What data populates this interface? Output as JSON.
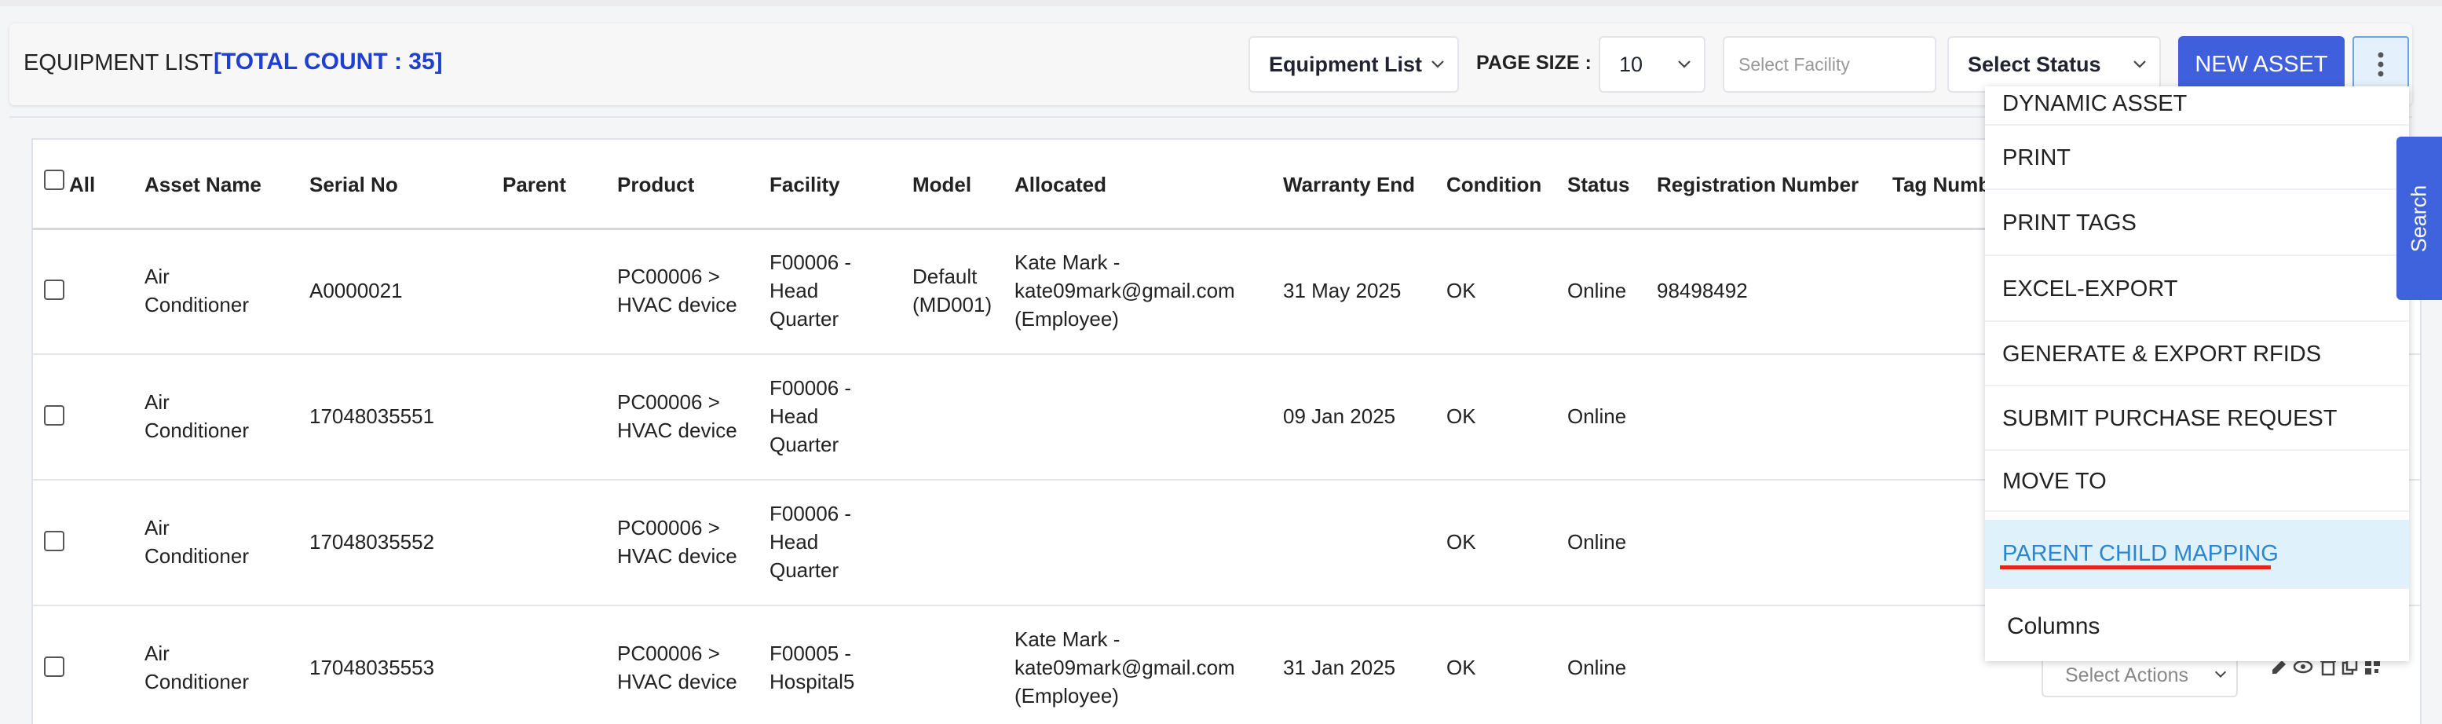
{
  "header": {
    "title": "EQUIPMENT LIST",
    "total_count": "[TOTAL COUNT : 35]",
    "view_select": "Equipment List",
    "page_size_label": "PAGE SIZE :",
    "page_size_value": "10",
    "facility_placeholder": "Select Facility",
    "status_select": "Select Status",
    "new_asset_label": "NEW ASSET"
  },
  "table": {
    "select_all_label": "All",
    "columns": [
      "Asset Name",
      "Serial No",
      "Parent",
      "Product",
      "Facility",
      "Model",
      "Allocated",
      "Warranty End",
      "Condition",
      "Status",
      "Registration Number",
      "Tag Numb"
    ],
    "rows": [
      {
        "asset_name": "Air\nConditioner",
        "serial_no": "A0000021",
        "parent": "",
        "product": "PC00006 >\nHVAC device",
        "facility": "F00006 -\nHead\nQuarter",
        "model": "Default\n(MD001)",
        "allocated": "Kate Mark -\nkate09mark@gmail.com\n(Employee)",
        "warranty_end": "31 May 2025",
        "condition": "OK",
        "status": "Online",
        "registration_number": "98498492"
      },
      {
        "asset_name": "Air\nConditioner",
        "serial_no": "17048035551",
        "parent": "",
        "product": "PC00006 >\nHVAC device",
        "facility": "F00006 -\nHead\nQuarter",
        "model": "",
        "allocated": "",
        "warranty_end": "09 Jan 2025",
        "condition": "OK",
        "status": "Online",
        "registration_number": ""
      },
      {
        "asset_name": "Air\nConditioner",
        "serial_no": "17048035552",
        "parent": "",
        "product": "PC00006 >\nHVAC device",
        "facility": "F00006 -\nHead\nQuarter",
        "model": "",
        "allocated": "",
        "warranty_end": "",
        "condition": "OK",
        "status": "Online",
        "registration_number": ""
      },
      {
        "asset_name": "Air\nConditioner",
        "serial_no": "17048035553",
        "parent": "",
        "product": "PC00006 >\nHVAC device",
        "facility": "F00005 -\nHospital5",
        "model": "",
        "allocated": "Kate Mark -\nkate09mark@gmail.com\n(Employee)",
        "warranty_end": "31 Jan 2025",
        "condition": "OK",
        "status": "Online",
        "registration_number": ""
      }
    ],
    "row_action_placeholder": "Select Actions"
  },
  "menu": {
    "items": [
      "DYNAMIC ASSET",
      "PRINT",
      "PRINT TAGS",
      "EXCEL-EXPORT",
      "GENERATE & EXPORT RFIDS",
      "SUBMIT PURCHASE REQUEST",
      "MOVE TO",
      "PARENT CHILD MAPPING",
      "Columns"
    ],
    "active_item": "PARENT CHILD MAPPING"
  },
  "search_tab": {
    "label": "Search"
  },
  "colors": {
    "accent": "#3f5fdc",
    "count": "#1f3fd1",
    "active_bg": "#dff1fa",
    "active_text": "#2a87d0",
    "underline": "#e0261d"
  },
  "icons": [
    "chevron-down-icon",
    "kebab-menu-icon",
    "edit-icon",
    "view-icon",
    "delete-icon",
    "copy-icon",
    "qr-icon"
  ]
}
